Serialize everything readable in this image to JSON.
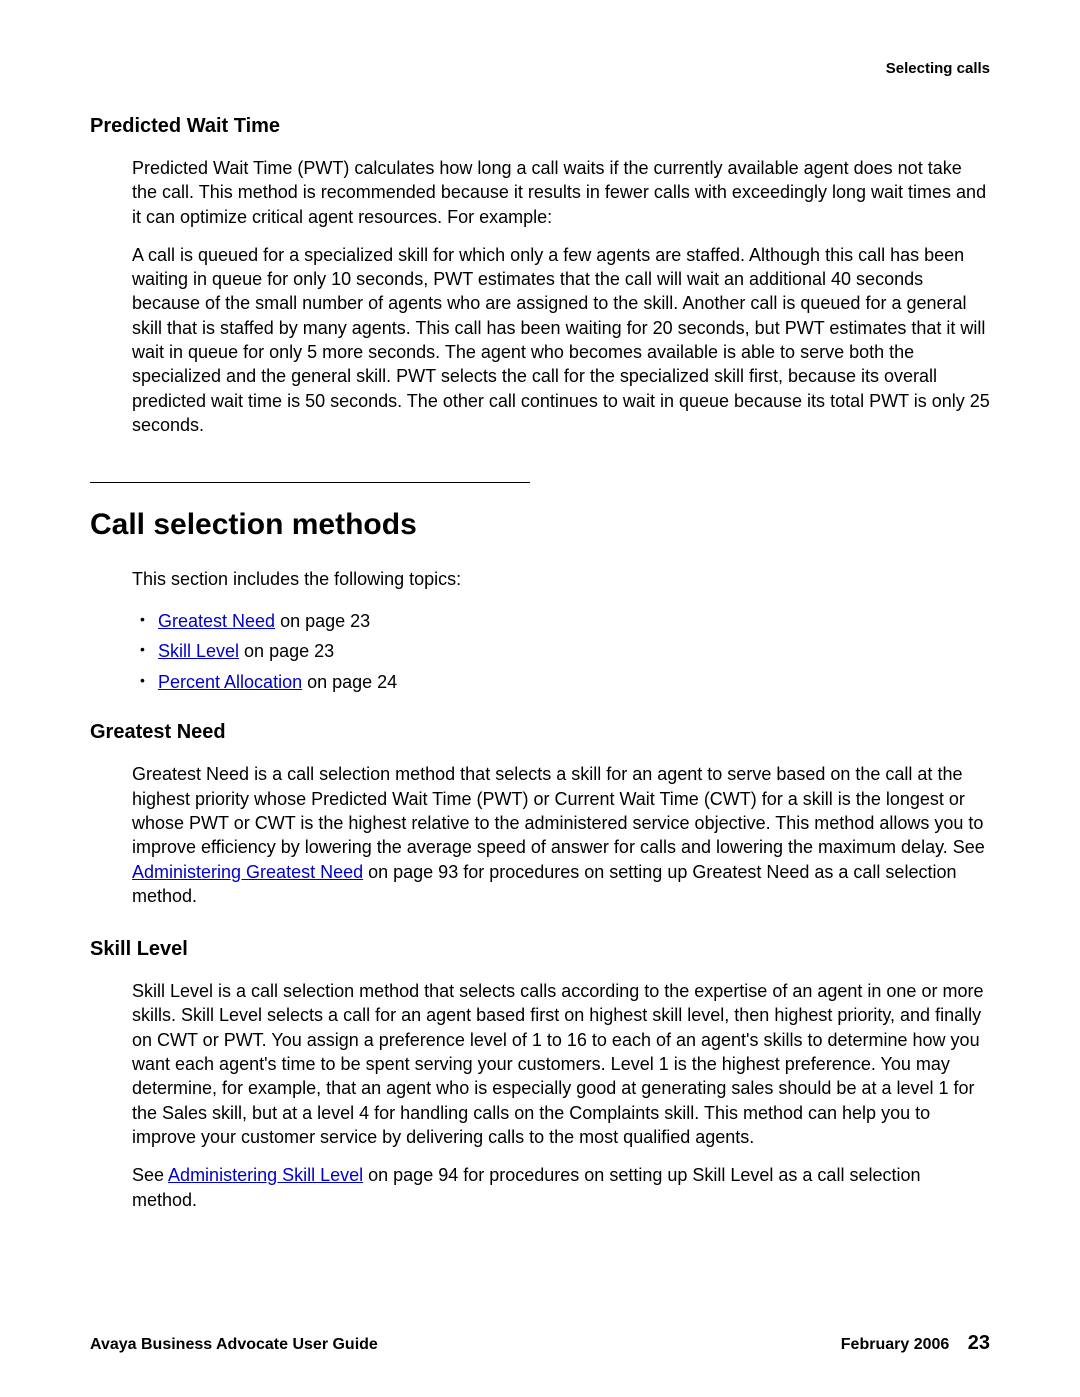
{
  "header": {
    "section_label": "Selecting calls"
  },
  "pwt": {
    "heading": "Predicted Wait Time",
    "para1": "Predicted Wait Time (PWT) calculates how long a call waits if the currently available agent does not take the call. This method is recommended because it results in fewer calls with exceedingly long wait times and it can optimize critical agent resources. For example:",
    "para2": "A call is queued for a specialized skill for which only a few agents are staffed. Although this call has been waiting in queue for only 10 seconds, PWT estimates that the call will wait an additional 40 seconds because of the small number of agents who are assigned to the skill. Another call is queued for a general skill that is staffed by many agents. This call has been waiting for 20 seconds, but PWT estimates that it will wait in queue for only 5 more seconds. The agent who becomes available is able to serve both the specialized and the general skill. PWT selects the call for the specialized skill first, because its overall predicted wait time is 50 seconds. The other call continues to wait in queue because its total PWT is only 25 seconds."
  },
  "csm": {
    "heading": "Call selection methods",
    "intro": "This section includes the following topics:",
    "bullets": [
      {
        "link": "Greatest Need",
        "suffix": " on page 23"
      },
      {
        "link": "Skill Level",
        "suffix": " on page 23"
      },
      {
        "link": "Percent Allocation",
        "suffix": " on page 24"
      }
    ]
  },
  "gn": {
    "heading": "Greatest Need",
    "para1_pre": "Greatest Need is a call selection method that selects a skill for an agent to serve based on the call at the highest priority whose Predicted Wait Time (PWT) or Current Wait Time (CWT) for a skill is the longest or whose PWT or CWT is the highest relative to the administered service objective. This method allows you to improve efficiency by lowering the average speed of answer for calls and lowering the maximum delay. See ",
    "para1_link": "Administering Greatest Need",
    "para1_post": " on page 93 for procedures on setting up Greatest Need as a call selection method."
  },
  "sl": {
    "heading": "Skill Level",
    "para1": "Skill Level is a call selection method that selects calls according to the expertise of an agent in one or more skills. Skill Level selects a call for an agent based first on highest skill level, then highest priority, and finally on CWT or PWT. You assign a preference level of 1 to 16 to each of an agent's skills to determine how you want each agent's time to be spent serving your customers. Level 1 is the highest preference. You may determine, for example, that an agent who is especially good at generating sales should be at a level 1 for the Sales skill, but at a level 4 for handling calls on the Complaints skill. This method can help you to improve your customer service by delivering calls to the most qualified agents.",
    "para2_pre": "See ",
    "para2_link": "Administering Skill Level",
    "para2_post": " on page 94 for procedures on setting up Skill Level as a call selection method."
  },
  "footer": {
    "left": "Avaya Business Advocate User Guide",
    "date": "February 2006",
    "page": "23"
  }
}
